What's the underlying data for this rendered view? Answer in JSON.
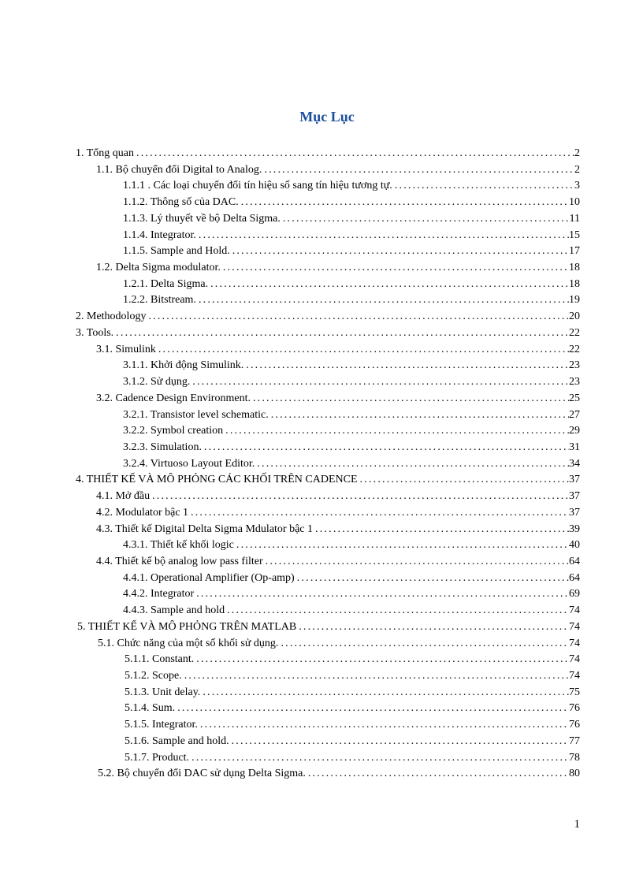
{
  "title": "Mục Lục",
  "pageNumber": "1",
  "entries": [
    {
      "label": "1.    Tổng quan",
      "page": "2",
      "cls": "l0"
    },
    {
      "label": "1.1.  Bộ chuyển đổi Digital  to Analog.",
      "page": "2",
      "cls": "l1"
    },
    {
      "label": "1.1.1 . Các loại chuyển đổi tín hiệu số sang tín hiệu tương tự.",
      "page": "3",
      "cls": "l2"
    },
    {
      "label": "1.1.2. Thông số của DAC.",
      "page": "10",
      "cls": "l2"
    },
    {
      "label": "1.1.3. Lý thuyết về bộ Delta Sigma.",
      "page": "11",
      "cls": "l2"
    },
    {
      "label": "1.1.4. Integrator.",
      "page": "15",
      "cls": "l2"
    },
    {
      "label": "1.1.5. Sample  and Hold.",
      "page": "17",
      "cls": "l2"
    },
    {
      "label": "1.2.  Delta Sigma modulator.",
      "page": "18",
      "cls": "l1"
    },
    {
      "label": "1.2.1. Delta Sigma.",
      "page": "18",
      "cls": "l2"
    },
    {
      "label": "1.2.2. Bitstream.",
      "page": "19",
      "cls": "l2"
    },
    {
      "label": "2.    Methodology",
      "page": "20",
      "cls": "l0"
    },
    {
      "label": "3.    Tools.",
      "page": "22",
      "cls": "l0"
    },
    {
      "label": "3.1.  Simulink",
      "page": "22",
      "cls": "l1"
    },
    {
      "label": "3.1.1. Khởi động Simulink.",
      "page": "23",
      "cls": "l2"
    },
    {
      "label": "3.1.2. Sử dụng.",
      "page": "23",
      "cls": "l2"
    },
    {
      "label": "3.2.  Cadence Design  Environment.",
      "page": "25",
      "cls": "l1"
    },
    {
      "label": "3.2.1. Transistor level  schematic.",
      "page": "27",
      "cls": "l2"
    },
    {
      "label": "3.2.2. Symbol creation",
      "page": "29",
      "cls": "l2"
    },
    {
      "label": "3.2.3. Simulation.",
      "page": "31",
      "cls": "l2"
    },
    {
      "label": "3.2.4. Virtuoso  Layout Editor.",
      "page": "34",
      "cls": "l2"
    },
    {
      "label": "4.     THIẾT KẾ VÀ MÔ PHỎNG CÁC KHỐI TRÊN CADENCE",
      "page": "37",
      "cls": "l0"
    },
    {
      "label": "4.1.  Mở đầu",
      "page": "37",
      "cls": "l1"
    },
    {
      "label": "4.2.  Modulator bậc 1",
      "page": "37",
      "cls": "l1"
    },
    {
      "label": "4.3.  Thiết kế Digital  Delta Sigma Mdulator bậc 1",
      "page": "39",
      "cls": "l1"
    },
    {
      "label": "4.3.1.  Thiết kế khối logic",
      "page": "40",
      "cls": "l2"
    },
    {
      "label": "4.4. Thiết kế bộ analog  low pass filter",
      "page": "64",
      "cls": "l1"
    },
    {
      "label": "4.4.1. Operational Amplifier  (Op-amp)",
      "page": "64",
      "cls": "l2"
    },
    {
      "label": "4.4.2.  Integrator",
      "page": "69",
      "cls": "l2"
    },
    {
      "label": "4.4.3.  Sample  and hold",
      "page": "74",
      "cls": "l2"
    },
    {
      "label": "5. THIẾT KẾ VÀ MÔ PHỎNG TRÊN MATLAB",
      "page": "74",
      "cls": "l0b"
    },
    {
      "label": "5.1. Chức năng  của một số khối sử dụng.",
      "page": "74",
      "cls": "l1b"
    },
    {
      "label": "5.1.1. Constant.",
      "page": "74",
      "cls": "l2b"
    },
    {
      "label": "5.1.2. Scope.",
      "page": "74",
      "cls": "l2b"
    },
    {
      "label": "5.1.3. Unit delay.",
      "page": "75",
      "cls": "l2b"
    },
    {
      "label": "5.1.4.  Sum.",
      "page": "76",
      "cls": "l2b"
    },
    {
      "label": "5.1.5. Integrator.",
      "page": "76",
      "cls": "l2b"
    },
    {
      "label": "5.1.6. Sample  and hold.",
      "page": "77",
      "cls": "l2b"
    },
    {
      "label": "5.1.7. Product.",
      "page": "78",
      "cls": "l2b"
    },
    {
      "label": "5.2. Bộ chuyển đổi DAC sử dụng Delta Sigma.",
      "page": "80",
      "cls": "l1b"
    }
  ]
}
